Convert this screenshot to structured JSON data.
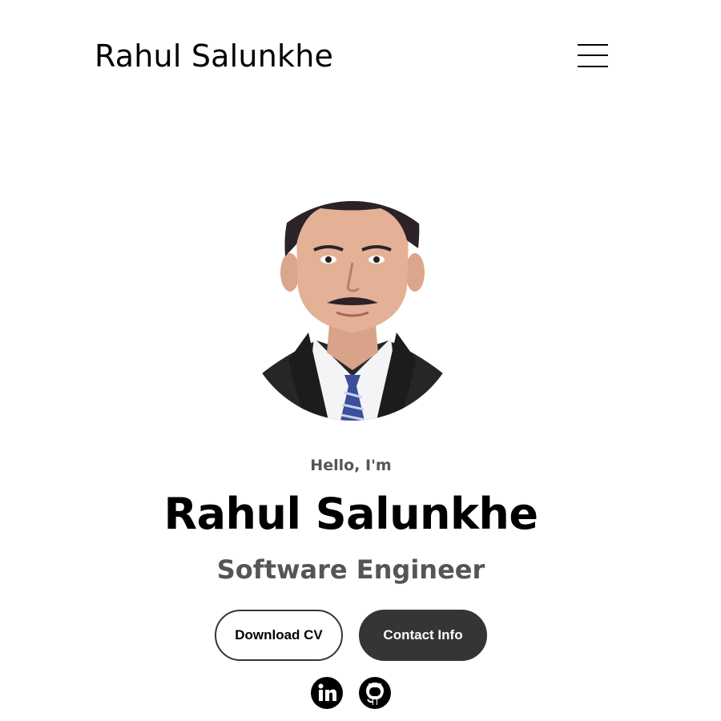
{
  "nav": {
    "logo": "Rahul Salunkhe",
    "menu_icon": "hamburger-menu-icon"
  },
  "hero": {
    "greeting": "Hello, I'm",
    "name": "Rahul Salunkhe",
    "role": "Software Engineer",
    "buttons": {
      "download_cv": "Download CV",
      "contact_info": "Contact Info"
    },
    "social": [
      {
        "icon": "linkedin-icon"
      },
      {
        "icon": "github-icon"
      }
    ]
  },
  "colors": {
    "text": "#000000",
    "subtle_text": "#555555",
    "button_dark": "#353535",
    "background": "#ffffff"
  }
}
